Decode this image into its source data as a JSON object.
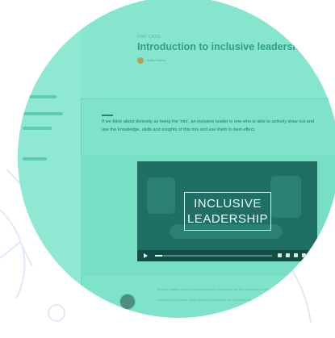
{
  "page": {
    "kicker": "HBR CASE",
    "title": "Introduction to inclusive leadership",
    "author": "Author name",
    "intro": "If we think about diversity as being the 'mix', an inclusive leader is one who is able to actively draw out and use the knowledge, skills and insights of this mix and use them to best effect."
  },
  "video": {
    "title_line1": "INCLUSIVE",
    "title_line2": "LEADERSHIP",
    "progress": 0.06
  },
  "comment": {
    "paragraph1": "Inclusive leaders ensure that everyone feels valued and has the opportunity to contribute their best work.",
    "paragraph2": "Creating environments where different perspectives are welcomed drives innovation."
  },
  "sidebar": {
    "items": [
      "",
      "",
      "",
      ""
    ]
  },
  "colors": {
    "accent": "#7fe3c9",
    "title": "#2f9e86",
    "video_bg": "#1f6f65"
  },
  "icons": [
    "play-icon",
    "volume-icon",
    "settings-icon",
    "fullscreen-icon",
    "avatar"
  ]
}
